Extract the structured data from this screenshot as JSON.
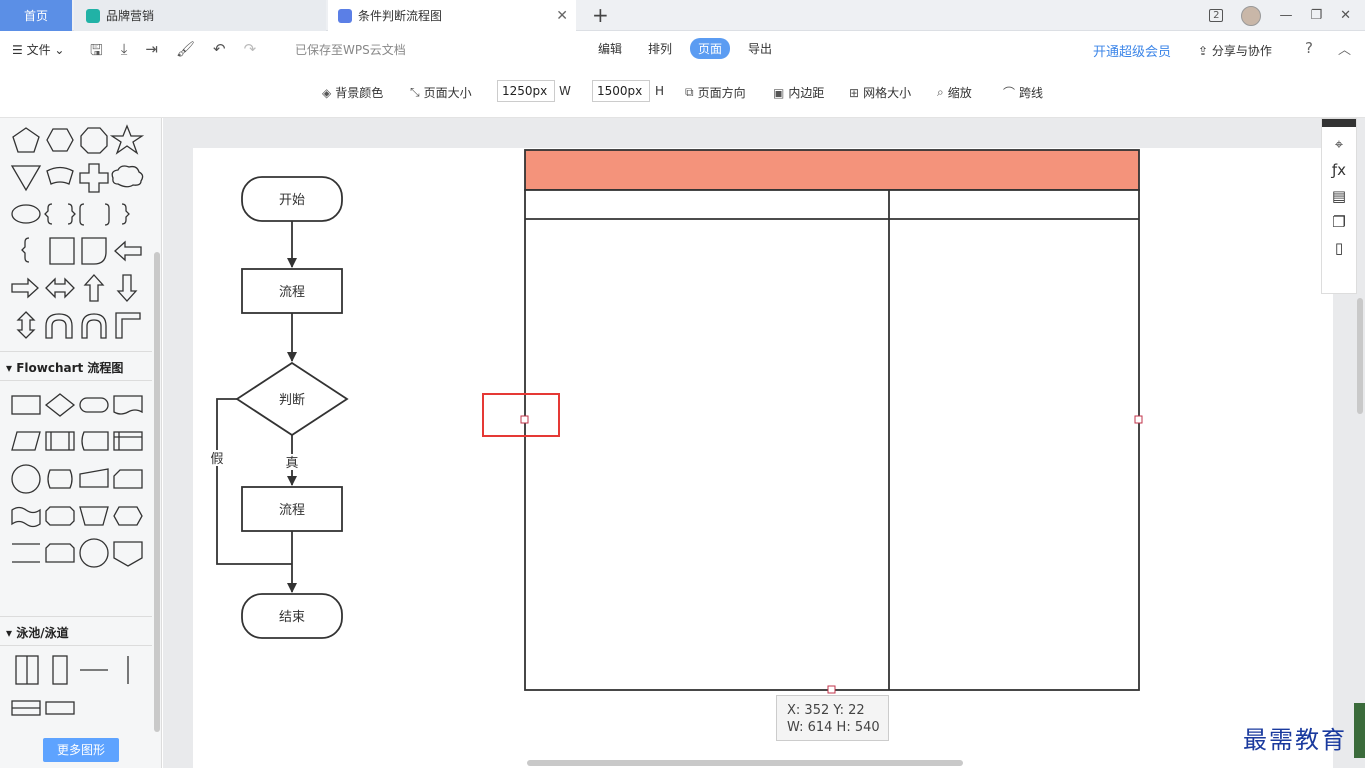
{
  "tabs": {
    "home": "首页",
    "brand": "品牌营销",
    "flow": "条件判断流程图",
    "add": "+"
  },
  "window": {
    "badge": "2",
    "minimize": "—",
    "restore": "❐",
    "close": "✕"
  },
  "menubar": {
    "file": "☰ 文件 ⌄",
    "saved": "已保存至WPS云文档",
    "tabs": [
      "编辑",
      "排列",
      "页面",
      "导出"
    ],
    "vip": "开通超级会员",
    "share": "分享与协作",
    "help": "?",
    "collapse": "︿"
  },
  "toolbar": {
    "bg_color": "背景颜色",
    "page_size": "页面大小",
    "width_value": "1250px",
    "width_unit": "W",
    "height_value": "1500px",
    "height_unit": "H",
    "orientation": "页面方向",
    "padding": "内边距",
    "grid_size": "网格大小",
    "zoom": "缩放",
    "jump_line": "跨线"
  },
  "panel": {
    "flowchart_section": "Flowchart 流程图",
    "swimlane_section": "泳池/泳道",
    "more_shapes": "更多图形",
    "misc_bracket": "["
  },
  "flowchart": {
    "start": "开始",
    "process1": "流程",
    "decision": "判断",
    "no_label": "假",
    "yes_label": "真",
    "process2": "流程",
    "end": "结束"
  },
  "swimlane": {
    "header_color": "#f4937b"
  },
  "dim_tip": {
    "line1": "X: 352  Y: 22",
    "line2": "W: 614  H: 540"
  },
  "watermark": "最需教育"
}
